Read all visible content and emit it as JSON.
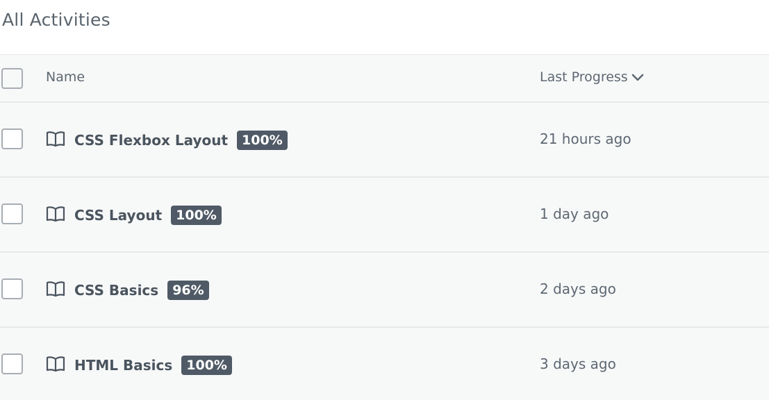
{
  "page": {
    "title": "All Activities"
  },
  "table": {
    "columns": {
      "name": "Name",
      "last_progress": "Last Progress"
    },
    "sort": {
      "column": "last_progress",
      "direction": "descending",
      "icon": "chevron-down-icon"
    },
    "rows": [
      {
        "name": "CSS Flexbox Layout",
        "progress": "100%",
        "last_progress": "21 hours ago",
        "icon": "book-icon"
      },
      {
        "name": "CSS Layout",
        "progress": "100%",
        "last_progress": "1 day ago",
        "icon": "book-icon"
      },
      {
        "name": "CSS Basics",
        "progress": "96%",
        "last_progress": "2 days ago",
        "icon": "book-icon"
      },
      {
        "name": "HTML Basics",
        "progress": "100%",
        "last_progress": "3 days ago",
        "icon": "book-icon"
      }
    ]
  },
  "colors": {
    "badge_bg": "#4f5a66",
    "table_bg": "#f7f8f8",
    "divider": "#e6e8ea"
  }
}
